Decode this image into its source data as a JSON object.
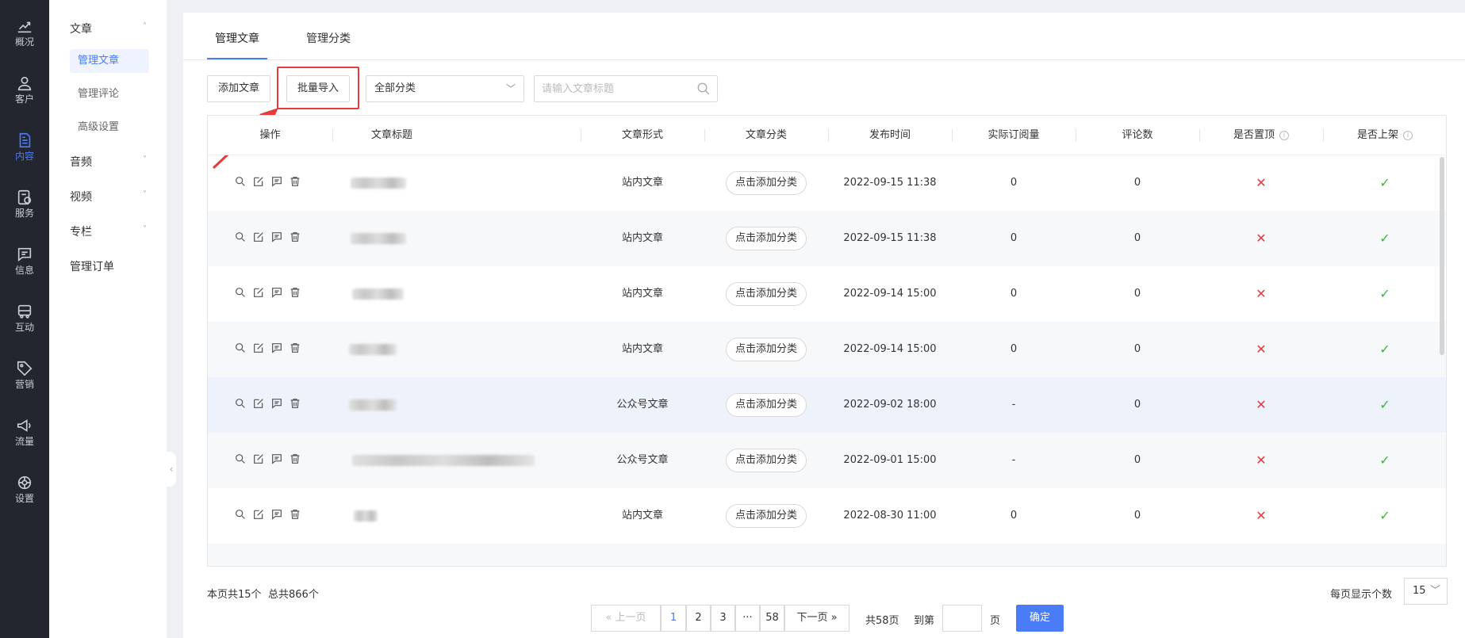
{
  "rail": [
    {
      "label": "概况",
      "icon": "chart-line-icon"
    },
    {
      "label": "客户",
      "icon": "user-icon"
    },
    {
      "label": "内容",
      "icon": "document-icon",
      "active": true
    },
    {
      "label": "服务",
      "icon": "service-icon"
    },
    {
      "label": "信息",
      "icon": "message-icon"
    },
    {
      "label": "互动",
      "icon": "bus-icon"
    },
    {
      "label": "营销",
      "icon": "tag-icon"
    },
    {
      "label": "流量",
      "icon": "megaphone-icon"
    },
    {
      "label": "设置",
      "icon": "settings-icon"
    }
  ],
  "submenu": {
    "article_group": "文章",
    "article_items": [
      "管理文章",
      "管理评论",
      "高级设置"
    ],
    "audio": "音频",
    "video": "视频",
    "column": "专栏",
    "orders": "管理订单"
  },
  "tabs": [
    "管理文章",
    "管理分类"
  ],
  "toolbar": {
    "add": "添加文章",
    "import": "批量导入",
    "category_select": "全部分类",
    "search_placeholder": "请输入文章标题"
  },
  "table": {
    "headers": [
      "操作",
      "文章标题",
      "文章形式",
      "文章分类",
      "发布时间",
      "实际订阅量",
      "评论数",
      "是否置顶",
      "是否上架"
    ],
    "rows": [
      {
        "form": "站内文章",
        "category": "点击添加分类",
        "time": "2022-09-15 11:38",
        "subs": "0",
        "comments": "0",
        "top": "✕",
        "online": "✓"
      },
      {
        "form": "站内文章",
        "category": "点击添加分类",
        "time": "2022-09-15 11:38",
        "subs": "0",
        "comments": "0",
        "top": "✕",
        "online": "✓"
      },
      {
        "form": "站内文章",
        "category": "点击添加分类",
        "time": "2022-09-14 15:00",
        "subs": "0",
        "comments": "0",
        "top": "✕",
        "online": "✓"
      },
      {
        "form": "站内文章",
        "category": "点击添加分类",
        "time": "2022-09-14 15:00",
        "subs": "0",
        "comments": "0",
        "top": "✕",
        "online": "✓"
      },
      {
        "form": "公众号文章",
        "category": "点击添加分类",
        "time": "2022-09-02 18:00",
        "subs": "-",
        "comments": "0",
        "top": "✕",
        "online": "✓"
      },
      {
        "form": "公众号文章",
        "category": "点击添加分类",
        "time": "2022-09-01 15:00",
        "subs": "-",
        "comments": "0",
        "top": "✕",
        "online": "✓"
      },
      {
        "form": "站内文章",
        "category": "点击添加分类",
        "time": "2022-08-30 11:00",
        "subs": "0",
        "comments": "0",
        "top": "✕",
        "online": "✓"
      }
    ]
  },
  "footer": {
    "page_count": "本页共15个",
    "total": "总共866个",
    "prev": "上一页",
    "pages": [
      "1",
      "2",
      "3",
      "···",
      "58"
    ],
    "next": "下一页",
    "total_pages": "共58页",
    "goto": "到第",
    "page_unit": "页",
    "confirm": "确定",
    "per_page_label": "每页显示个数",
    "per_page_value": "15"
  },
  "colors": {
    "accent": "#4a7cf7",
    "rail_bg": "#23262e",
    "danger": "#e23b3b",
    "success": "#3db33d"
  }
}
